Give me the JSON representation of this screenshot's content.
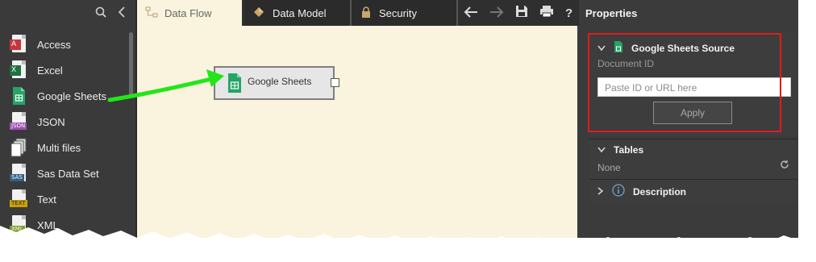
{
  "sources": [
    {
      "label": "Access",
      "icon": "access-icon",
      "tag": "A",
      "color": "#c7363e"
    },
    {
      "label": "Excel",
      "icon": "excel-icon",
      "tag": "X",
      "color": "#1e7145"
    },
    {
      "label": "Google Sheets",
      "icon": "google-sheets-icon",
      "tag": "",
      "color": "#23a566"
    },
    {
      "label": "JSON",
      "icon": "json-icon",
      "tag": "JSON",
      "color": "#9c4fb0"
    },
    {
      "label": "Multi files",
      "icon": "multi-files-icon",
      "tag": "",
      "color": "#bdbdbd"
    },
    {
      "label": "Sas Data Set",
      "icon": "sas-icon",
      "tag": "SAS",
      "color": "#2f5f8a"
    },
    {
      "label": "Text",
      "icon": "text-icon",
      "tag": "TEXT",
      "color": "#c9a20a"
    },
    {
      "label": "XML",
      "icon": "xml-icon",
      "tag": "XML",
      "color": "#7d9b2f"
    }
  ],
  "tabs": {
    "data_flow": "Data Flow",
    "data_model": "Data Model",
    "security": "Security"
  },
  "node": {
    "label": "Google Sheets"
  },
  "properties": {
    "title": "Properties",
    "source_title": "Google Sheets Source",
    "document_id_label": "Document ID",
    "input_placeholder": "Paste ID or URL here",
    "apply": "Apply",
    "tables_title": "Tables",
    "tables_value": "None",
    "description_title": "Description"
  },
  "colors": {
    "accent_red": "#e01b1b",
    "arrow_green": "#22e61a",
    "canvas_bg": "#faf3de",
    "panel_bg": "#3b3b3b"
  }
}
